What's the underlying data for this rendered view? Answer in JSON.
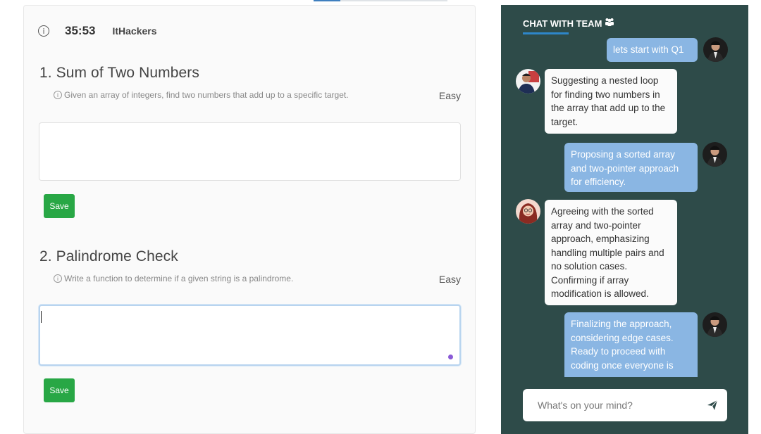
{
  "header": {
    "timer": "35:53",
    "brand": "ItHackers"
  },
  "questions": [
    {
      "title": "1. Sum of Two Numbers",
      "description": "Given an array of integers, find two numbers that add up to a specific target.",
      "difficulty": "Easy",
      "answer": "",
      "save_label": "Save"
    },
    {
      "title": "2. Palindrome Check",
      "description": "Write a function to determine if a given string is a palindrome.",
      "difficulty": "Easy",
      "answer": "",
      "save_label": "Save"
    }
  ],
  "chat": {
    "title": "CHAT WITH TEAM",
    "title_icon": "team-icon",
    "messages": [
      {
        "sender": "me",
        "text": "lets start with Q1"
      },
      {
        "sender": "other",
        "text": "Suggesting a nested loop for finding two numbers in the array that add up to the target."
      },
      {
        "sender": "me",
        "text": "Proposing a sorted array and two-pointer approach for efficiency."
      },
      {
        "sender": "other",
        "text": "Agreeing with the sorted array and two-pointer approach, emphasizing handling multiple pairs and no solution cases. Confirming if array modification is allowed."
      },
      {
        "sender": "me",
        "text": "Finalizing the approach, considering edge cases. Ready to proceed with coding once everyone is"
      }
    ],
    "input_placeholder": "What's on your mind?",
    "send_icon": "send-icon"
  },
  "colors": {
    "chat_bg": "#2e4b49",
    "my_bubble": "#8ab6e3",
    "other_bubble": "#fbfbfb",
    "save_button": "#28a745",
    "accent": "#2e86c9"
  }
}
